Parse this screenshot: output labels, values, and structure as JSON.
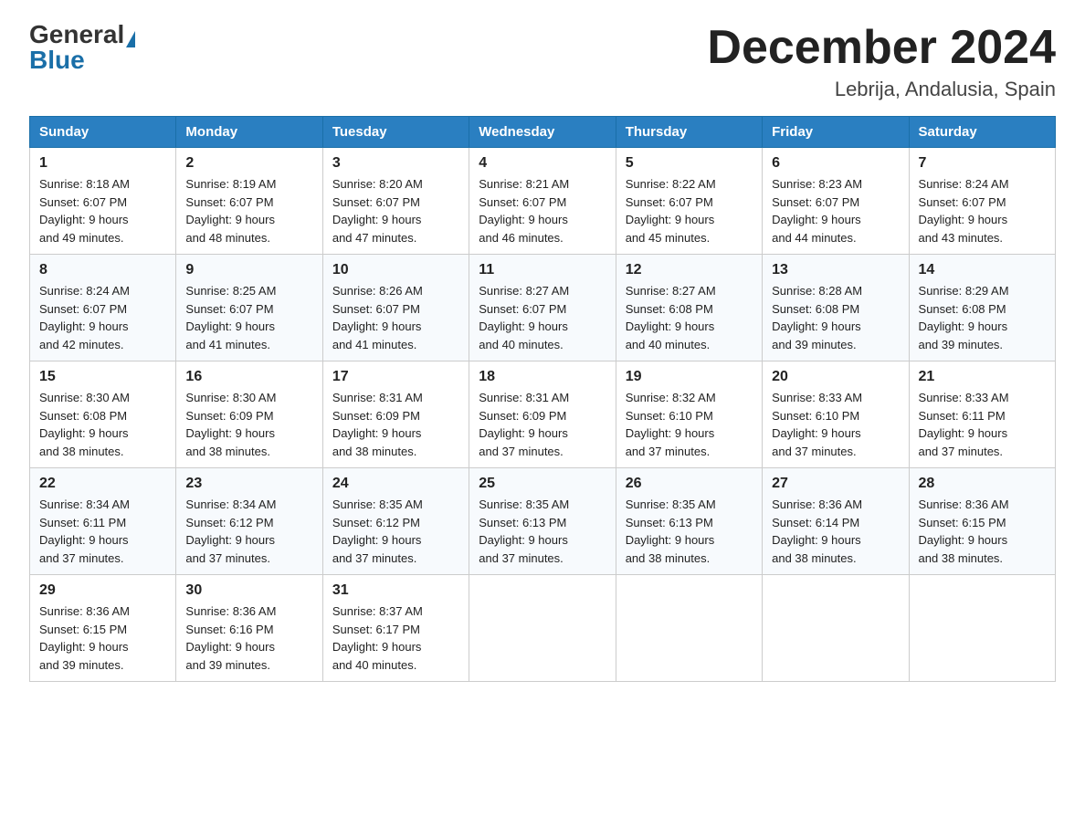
{
  "header": {
    "logo_general": "General",
    "logo_blue": "Blue",
    "month_title": "December 2024",
    "location": "Lebrija, Andalusia, Spain"
  },
  "days_of_week": [
    "Sunday",
    "Monday",
    "Tuesday",
    "Wednesday",
    "Thursday",
    "Friday",
    "Saturday"
  ],
  "weeks": [
    [
      {
        "day": "1",
        "sunrise": "8:18 AM",
        "sunset": "6:07 PM",
        "daylight": "9 hours and 49 minutes."
      },
      {
        "day": "2",
        "sunrise": "8:19 AM",
        "sunset": "6:07 PM",
        "daylight": "9 hours and 48 minutes."
      },
      {
        "day": "3",
        "sunrise": "8:20 AM",
        "sunset": "6:07 PM",
        "daylight": "9 hours and 47 minutes."
      },
      {
        "day": "4",
        "sunrise": "8:21 AM",
        "sunset": "6:07 PM",
        "daylight": "9 hours and 46 minutes."
      },
      {
        "day": "5",
        "sunrise": "8:22 AM",
        "sunset": "6:07 PM",
        "daylight": "9 hours and 45 minutes."
      },
      {
        "day": "6",
        "sunrise": "8:23 AM",
        "sunset": "6:07 PM",
        "daylight": "9 hours and 44 minutes."
      },
      {
        "day": "7",
        "sunrise": "8:24 AM",
        "sunset": "6:07 PM",
        "daylight": "9 hours and 43 minutes."
      }
    ],
    [
      {
        "day": "8",
        "sunrise": "8:24 AM",
        "sunset": "6:07 PM",
        "daylight": "9 hours and 42 minutes."
      },
      {
        "day": "9",
        "sunrise": "8:25 AM",
        "sunset": "6:07 PM",
        "daylight": "9 hours and 41 minutes."
      },
      {
        "day": "10",
        "sunrise": "8:26 AM",
        "sunset": "6:07 PM",
        "daylight": "9 hours and 41 minutes."
      },
      {
        "day": "11",
        "sunrise": "8:27 AM",
        "sunset": "6:07 PM",
        "daylight": "9 hours and 40 minutes."
      },
      {
        "day": "12",
        "sunrise": "8:27 AM",
        "sunset": "6:08 PM",
        "daylight": "9 hours and 40 minutes."
      },
      {
        "day": "13",
        "sunrise": "8:28 AM",
        "sunset": "6:08 PM",
        "daylight": "9 hours and 39 minutes."
      },
      {
        "day": "14",
        "sunrise": "8:29 AM",
        "sunset": "6:08 PM",
        "daylight": "9 hours and 39 minutes."
      }
    ],
    [
      {
        "day": "15",
        "sunrise": "8:30 AM",
        "sunset": "6:08 PM",
        "daylight": "9 hours and 38 minutes."
      },
      {
        "day": "16",
        "sunrise": "8:30 AM",
        "sunset": "6:09 PM",
        "daylight": "9 hours and 38 minutes."
      },
      {
        "day": "17",
        "sunrise": "8:31 AM",
        "sunset": "6:09 PM",
        "daylight": "9 hours and 38 minutes."
      },
      {
        "day": "18",
        "sunrise": "8:31 AM",
        "sunset": "6:09 PM",
        "daylight": "9 hours and 37 minutes."
      },
      {
        "day": "19",
        "sunrise": "8:32 AM",
        "sunset": "6:10 PM",
        "daylight": "9 hours and 37 minutes."
      },
      {
        "day": "20",
        "sunrise": "8:33 AM",
        "sunset": "6:10 PM",
        "daylight": "9 hours and 37 minutes."
      },
      {
        "day": "21",
        "sunrise": "8:33 AM",
        "sunset": "6:11 PM",
        "daylight": "9 hours and 37 minutes."
      }
    ],
    [
      {
        "day": "22",
        "sunrise": "8:34 AM",
        "sunset": "6:11 PM",
        "daylight": "9 hours and 37 minutes."
      },
      {
        "day": "23",
        "sunrise": "8:34 AM",
        "sunset": "6:12 PM",
        "daylight": "9 hours and 37 minutes."
      },
      {
        "day": "24",
        "sunrise": "8:35 AM",
        "sunset": "6:12 PM",
        "daylight": "9 hours and 37 minutes."
      },
      {
        "day": "25",
        "sunrise": "8:35 AM",
        "sunset": "6:13 PM",
        "daylight": "9 hours and 37 minutes."
      },
      {
        "day": "26",
        "sunrise": "8:35 AM",
        "sunset": "6:13 PM",
        "daylight": "9 hours and 38 minutes."
      },
      {
        "day": "27",
        "sunrise": "8:36 AM",
        "sunset": "6:14 PM",
        "daylight": "9 hours and 38 minutes."
      },
      {
        "day": "28",
        "sunrise": "8:36 AM",
        "sunset": "6:15 PM",
        "daylight": "9 hours and 38 minutes."
      }
    ],
    [
      {
        "day": "29",
        "sunrise": "8:36 AM",
        "sunset": "6:15 PM",
        "daylight": "9 hours and 39 minutes."
      },
      {
        "day": "30",
        "sunrise": "8:36 AM",
        "sunset": "6:16 PM",
        "daylight": "9 hours and 39 minutes."
      },
      {
        "day": "31",
        "sunrise": "8:37 AM",
        "sunset": "6:17 PM",
        "daylight": "9 hours and 40 minutes."
      },
      null,
      null,
      null,
      null
    ]
  ],
  "labels": {
    "sunrise": "Sunrise:",
    "sunset": "Sunset:",
    "daylight": "Daylight:"
  }
}
